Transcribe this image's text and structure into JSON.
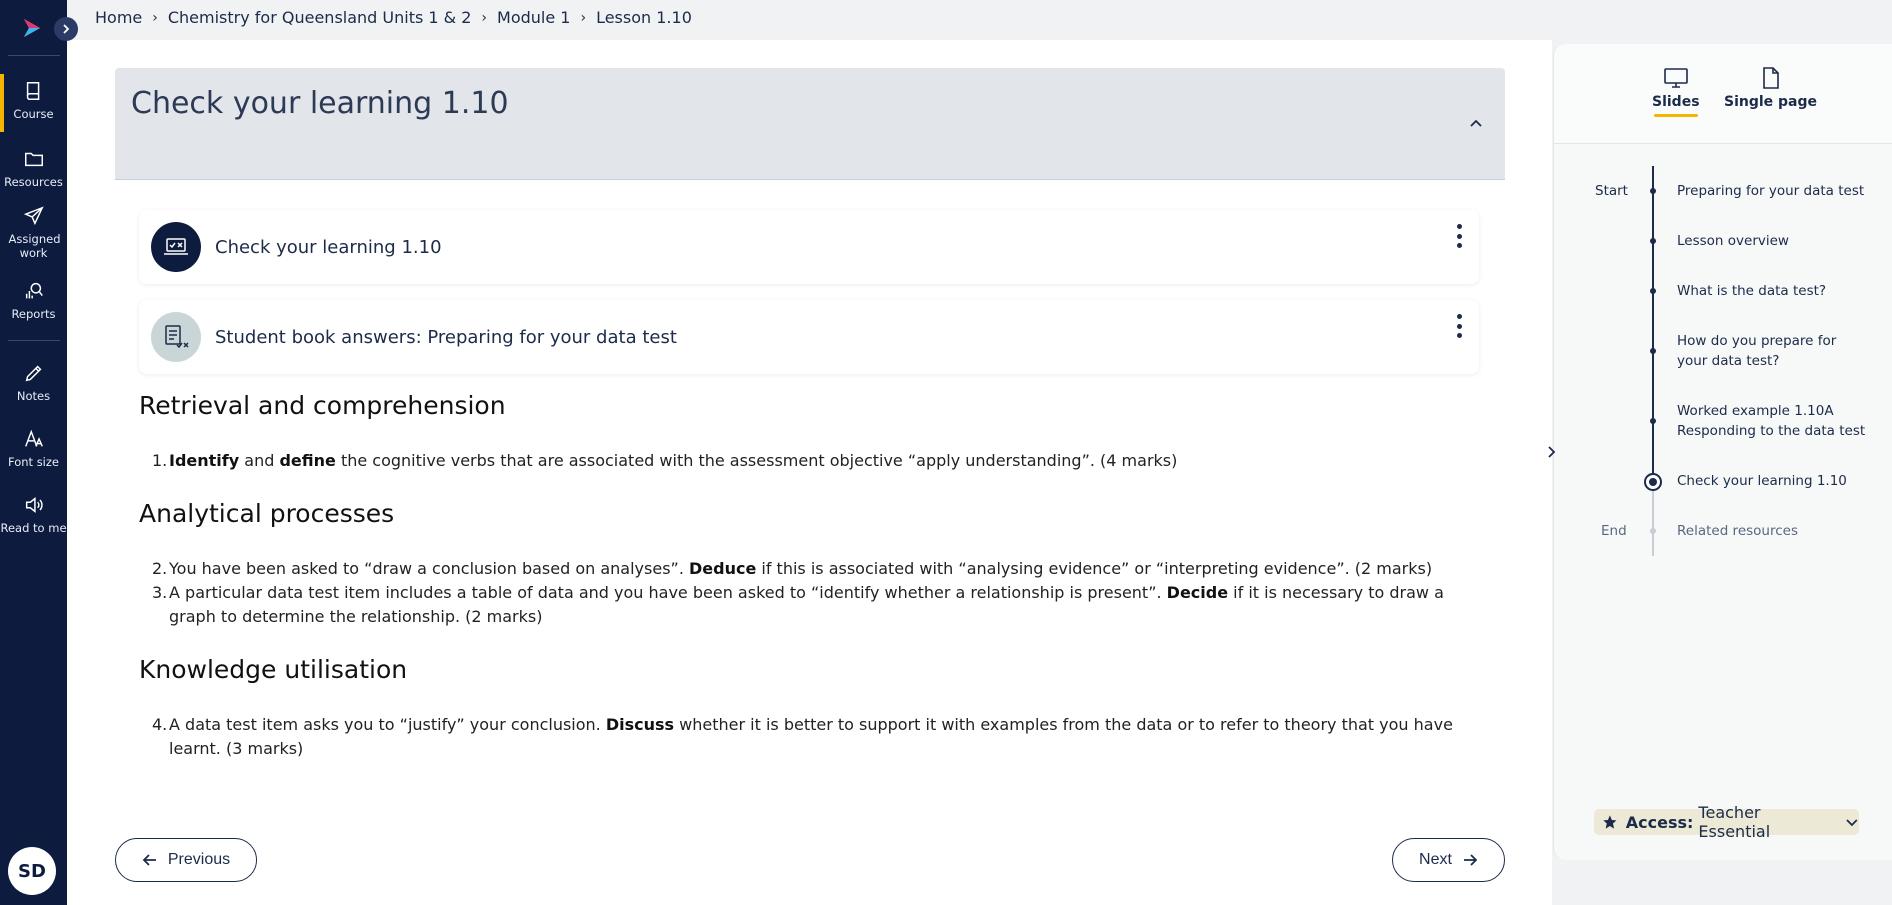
{
  "breadcrumb": {
    "items": [
      "Home",
      "Chemistry for Queensland Units 1 & 2",
      "Module 1",
      "Lesson 1.10"
    ]
  },
  "nav": {
    "items": [
      {
        "label": "Course",
        "icon": "book-icon",
        "active": true
      },
      {
        "label": "Resources",
        "icon": "folder-icon"
      },
      {
        "label": "Assigned work",
        "icon": "paper-plane-icon"
      },
      {
        "label": "Reports",
        "icon": "reports-icon"
      },
      {
        "label": "Notes",
        "icon": "pencil-icon"
      },
      {
        "label": "Font size",
        "icon": "font-size-icon"
      },
      {
        "label": "Read to me",
        "icon": "speaker-icon"
      }
    ],
    "avatar": "SD"
  },
  "section": {
    "title": "Check your learning 1.10"
  },
  "cards": [
    {
      "title": "Check your learning 1.10",
      "icon": "quiz-laptop-icon"
    },
    {
      "title": "Student book answers: Preparing for your data test",
      "icon": "answers-checklist-icon"
    }
  ],
  "content": {
    "heading1": "Retrieval and comprehension",
    "q1": {
      "num": "1.",
      "b1": "Identify",
      "t1": " and ",
      "b2": "define",
      "t2": " the cognitive verbs that are associated with the assessment objective “apply understanding”. (4 marks)"
    },
    "heading2": "Analytical processes",
    "q2": {
      "num": "2.",
      "t1": "You have been asked to “draw a conclusion based on analyses”. ",
      "b1": "Deduce",
      "t2": " if this is associated with “analysing evidence” or “interpreting evidence”. (2 marks)"
    },
    "q3": {
      "num": "3.",
      "t1": "A particular data test item includes a table of data and you have been asked to “identify whether a relationship is present”. ",
      "b1": "Decide",
      "t2": " if it is necessary to draw a graph to determine the relationship. (2 marks)"
    },
    "heading3": "Knowledge utilisation",
    "q4": {
      "num": "4.",
      "t1": "A data test item asks you to “justify” your conclusion. ",
      "b1": "Discuss",
      "t2": " whether it is better to support it with examples from the data or to refer to theory that you have learnt. (3 marks)"
    }
  },
  "buttons": {
    "previous": "Previous",
    "next": "Next"
  },
  "rightpanel": {
    "tabs": [
      {
        "label": "Slides",
        "icon": "monitor-icon",
        "active": true
      },
      {
        "label": "Single page",
        "icon": "page-icon"
      }
    ],
    "start_label": "Start",
    "end_label": "End",
    "timeline": [
      "Preparing for your data test",
      "Lesson overview",
      "What is the data test?",
      "How do you prepare for your data test?",
      "Worked example 1.10A Responding to the data test",
      "Check your learning 1.10",
      "Related resources"
    ],
    "access_label": "Access:",
    "access_value": "Teacher Essential"
  },
  "colors": {
    "nav_bg": "#0d1b3e",
    "accent": "#f4b400",
    "text": "#1c2b4a"
  }
}
